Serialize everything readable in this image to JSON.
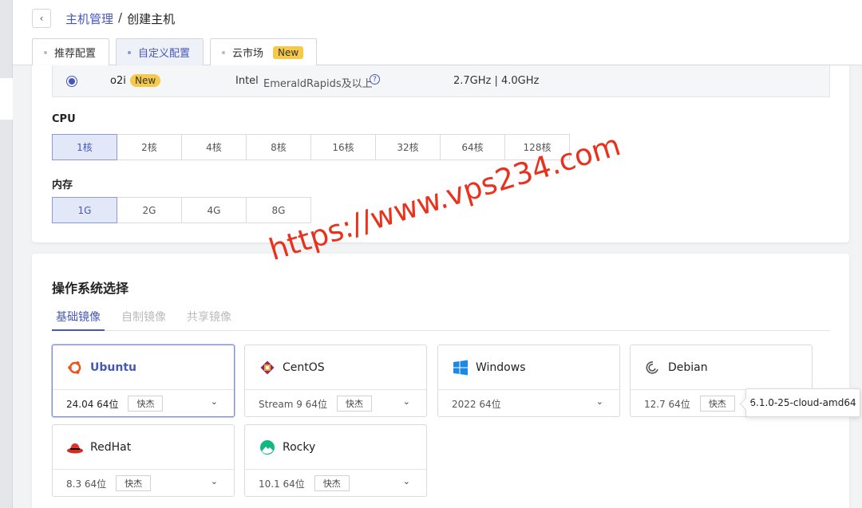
{
  "breadcrumb": {
    "parent": "主机管理",
    "separator": "/",
    "current": "创建主机"
  },
  "tabs": [
    {
      "label": "推荐配置"
    },
    {
      "label": "自定义配置"
    },
    {
      "label": "云市场",
      "badge": "New"
    }
  ],
  "spec": {
    "name": "o2i",
    "badge": "New",
    "vendor": "Intel",
    "arch": "EmeraldRapids及以上",
    "freq": "2.7GHz | 4.0GHz"
  },
  "cpu": {
    "label": "CPU",
    "options": [
      "1核",
      "2核",
      "4核",
      "8核",
      "16核",
      "32核",
      "64核",
      "128核"
    ],
    "selected": "1核"
  },
  "memory": {
    "label": "内存",
    "options": [
      "1G",
      "2G",
      "4G",
      "8G"
    ],
    "selected": "1G"
  },
  "os": {
    "title": "操作系统选择",
    "tabs": [
      "基础镜像",
      "自制镜像",
      "共享镜像"
    ],
    "cards": [
      {
        "name": "Ubuntu",
        "version": "24.04 64位",
        "tag": "快杰",
        "icon": "ubuntu-icon"
      },
      {
        "name": "CentOS",
        "version": "Stream 9 64位",
        "tag": "快杰",
        "icon": "centos-icon"
      },
      {
        "name": "Windows",
        "version": "2022 64位",
        "icon": "windows-icon"
      },
      {
        "name": "Debian",
        "version": "12.7 64位",
        "tag": "快杰",
        "icon": "debian-icon"
      },
      {
        "name": "RedHat",
        "version": "8.3 64位",
        "tag": "快杰",
        "icon": "redhat-icon"
      },
      {
        "name": "Rocky",
        "version": "10.1 64位",
        "tag": "快杰",
        "icon": "rocky-icon"
      }
    ],
    "tooltip": "6.1.0-25-cloud-amd64"
  },
  "watermark": "https://www.vps234.com",
  "colors": {
    "accent": "#4658b8",
    "badge": "#f6c94a",
    "selected_bg": "#e2e8f7",
    "watermark": "#e8321e"
  }
}
